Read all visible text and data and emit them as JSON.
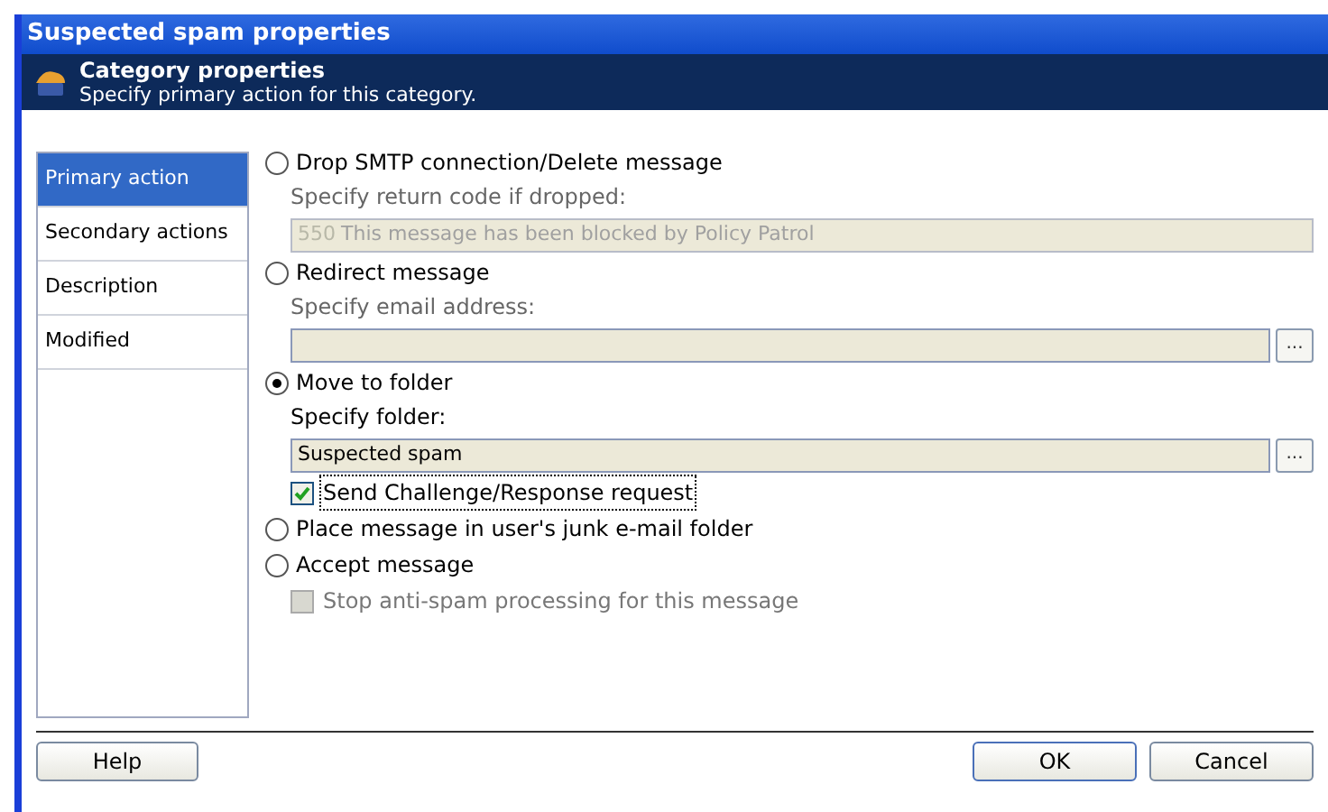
{
  "window": {
    "title": "Suspected spam properties"
  },
  "header": {
    "title": "Category properties",
    "subtitle": "Specify primary action for this category."
  },
  "sidebar": {
    "items": [
      {
        "label": "Primary action",
        "selected": true
      },
      {
        "label": "Secondary actions",
        "selected": false
      },
      {
        "label": "Description",
        "selected": false
      },
      {
        "label": "Modified",
        "selected": false
      }
    ]
  },
  "options": [
    {
      "kind": "radio",
      "label": "Drop SMTP connection/Delete message",
      "selected": false,
      "sub_label": "Specify return code if dropped:",
      "field": {
        "prefix": "550",
        "value": "This message has been blocked by Policy Patrol",
        "disabled": true
      }
    },
    {
      "kind": "radio",
      "label": "Redirect message",
      "selected": false,
      "sub_label": "Specify email address:",
      "field": {
        "browse": "..."
      }
    },
    {
      "kind": "radio",
      "label": "Move to folder",
      "selected": true,
      "sub_label": "Specify folder:",
      "field": {
        "value": "Suspected spam",
        "browse": "..."
      }
    },
    {
      "kind": "checkbox",
      "label": "Send Challenge/Response request",
      "checked": true,
      "disabled": false,
      "focused": true
    },
    {
      "kind": "radio",
      "label": "Place message in user's junk e-mail folder",
      "selected": false
    },
    {
      "kind": "radio",
      "label": "Accept message",
      "selected": false
    },
    {
      "kind": "checkbox",
      "label": "Stop anti-spam processing for this message",
      "checked": false,
      "disabled": true,
      "focused": false
    }
  ],
  "buttons": {
    "help": "Help",
    "ok": "OK",
    "cancel": "Cancel"
  }
}
